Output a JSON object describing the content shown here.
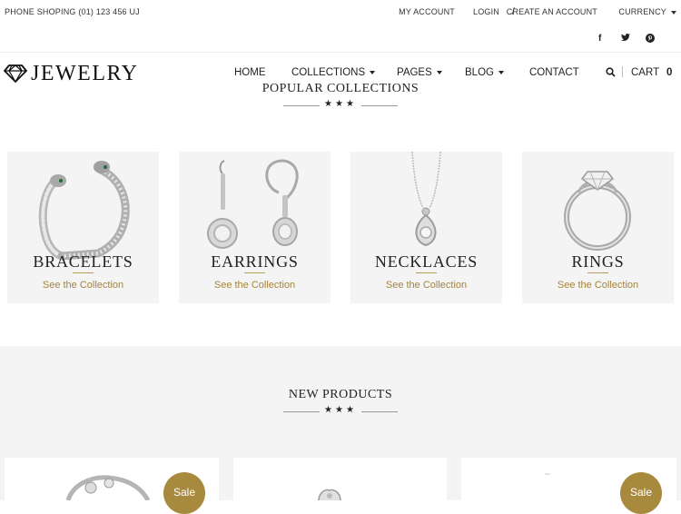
{
  "topbar": {
    "phone": "PHONE SHOPING (01) 123 456 UJ",
    "my_account": "MY ACCOUNT",
    "login": "LOGIN",
    "slash": "/",
    "create_account": "CREATE AN ACCOUNT",
    "currency": "CURRENCY"
  },
  "social": {
    "facebook": "f",
    "twitter": "t",
    "pinterest": "p"
  },
  "logo": {
    "text": "JEWELRY",
    "icon": "diamond-icon"
  },
  "nav": {
    "home": "HOME",
    "collections": "COLLECTIONS",
    "pages": "PAGES",
    "blog": "BLOG",
    "contact": "CONTACT",
    "cart": "CART",
    "cart_count": "0"
  },
  "popular": {
    "title": "POPULAR COLLECTIONS",
    "stars": "★★★",
    "cards": [
      {
        "title": "BRACELETS",
        "link": "See the Collection"
      },
      {
        "title": "EARRINGS",
        "link": "See the Collection"
      },
      {
        "title": "NECKLACES",
        "link": "See the Collection"
      },
      {
        "title": "RINGS",
        "link": "See the Collection"
      }
    ]
  },
  "new_products": {
    "title": "NEW PRODUCTS",
    "stars": "★★★",
    "sale_label": "Sale"
  },
  "colors": {
    "accent": "#a88a3f",
    "card_bg": "#f4f4f4"
  }
}
